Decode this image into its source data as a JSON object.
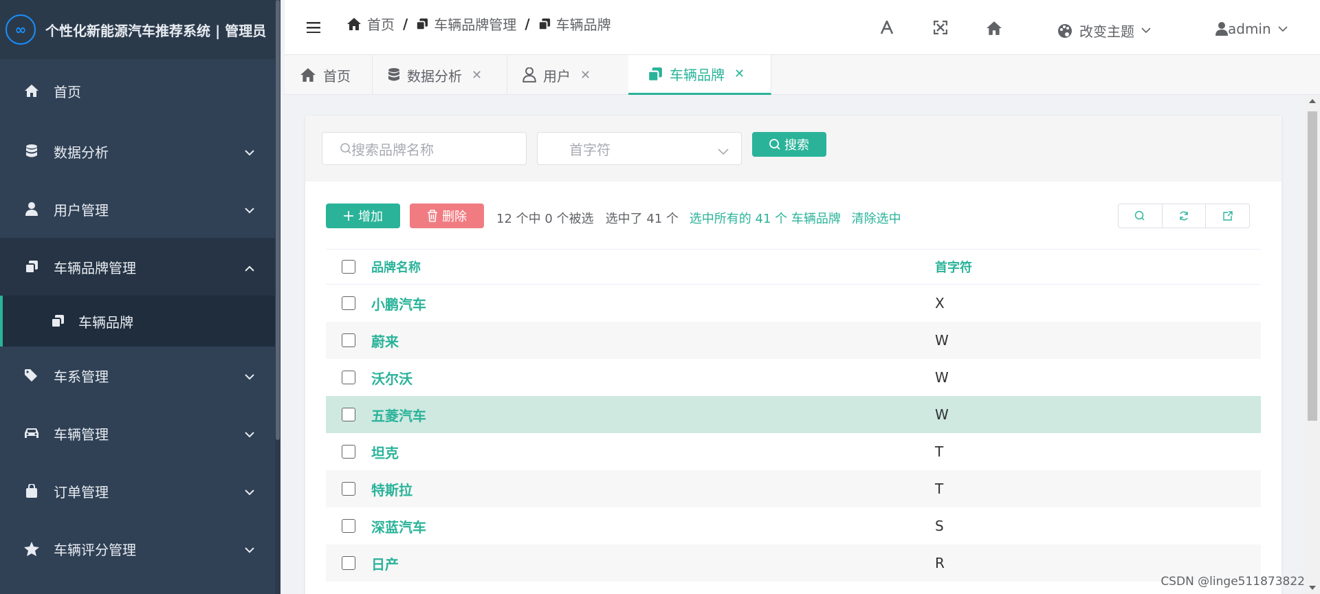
{
  "app": {
    "title": "个性化新能源汽车推荐系统 | 管理员",
    "logo_text": "∞"
  },
  "sidebar": {
    "items": [
      {
        "label": "首页",
        "icon": "home-icon"
      },
      {
        "label": "数据分析",
        "icon": "database-icon"
      },
      {
        "label": "用户管理",
        "icon": "user-icon"
      },
      {
        "label": "车辆品牌管理",
        "icon": "copy-icon"
      },
      {
        "label": "车辆品牌",
        "icon": "copy-icon"
      },
      {
        "label": "车系管理",
        "icon": "tag-icon"
      },
      {
        "label": "车辆管理",
        "icon": "car-icon"
      },
      {
        "label": "订单管理",
        "icon": "bag-icon"
      },
      {
        "label": "车辆评分管理",
        "icon": "star-icon"
      }
    ]
  },
  "header": {
    "breadcrumbs": [
      "首页",
      "车辆品牌管理",
      "车辆品牌"
    ],
    "theme_label": "改变主题",
    "user_label": "admin"
  },
  "tabs": [
    {
      "label": "首页",
      "closable": false
    },
    {
      "label": "数据分析",
      "closable": true
    },
    {
      "label": "用户",
      "closable": true
    },
    {
      "label": "车辆品牌",
      "closable": true,
      "active": true
    }
  ],
  "filters": {
    "search_placeholder": "搜索品牌名称",
    "select_placeholder": "首字符",
    "search_button": "搜索"
  },
  "toolbar": {
    "add_label": "增加",
    "delete_label": "删除",
    "selection_info": "12 个中 0 个被选   选中了 41 个",
    "select_all_link": "选中所有的 41 个 车辆品牌",
    "clear_link": "清除选中"
  },
  "table": {
    "columns": [
      "品牌名称",
      "首字符"
    ],
    "rows": [
      {
        "name": "小鹏汽车",
        "letter": "X"
      },
      {
        "name": "蔚来",
        "letter": "W"
      },
      {
        "name": "沃尔沃",
        "letter": "W"
      },
      {
        "name": "五菱汽车",
        "letter": "W"
      },
      {
        "name": "坦克",
        "letter": "T"
      },
      {
        "name": "特斯拉",
        "letter": "T"
      },
      {
        "name": "深蓝汽车",
        "letter": "S"
      },
      {
        "name": "日产",
        "letter": "R"
      }
    ]
  },
  "watermark": "CSDN @linge511873822",
  "colors": {
    "accent": "#2ab399",
    "danger": "#f07c82",
    "sidebar_bg": "#304156"
  }
}
